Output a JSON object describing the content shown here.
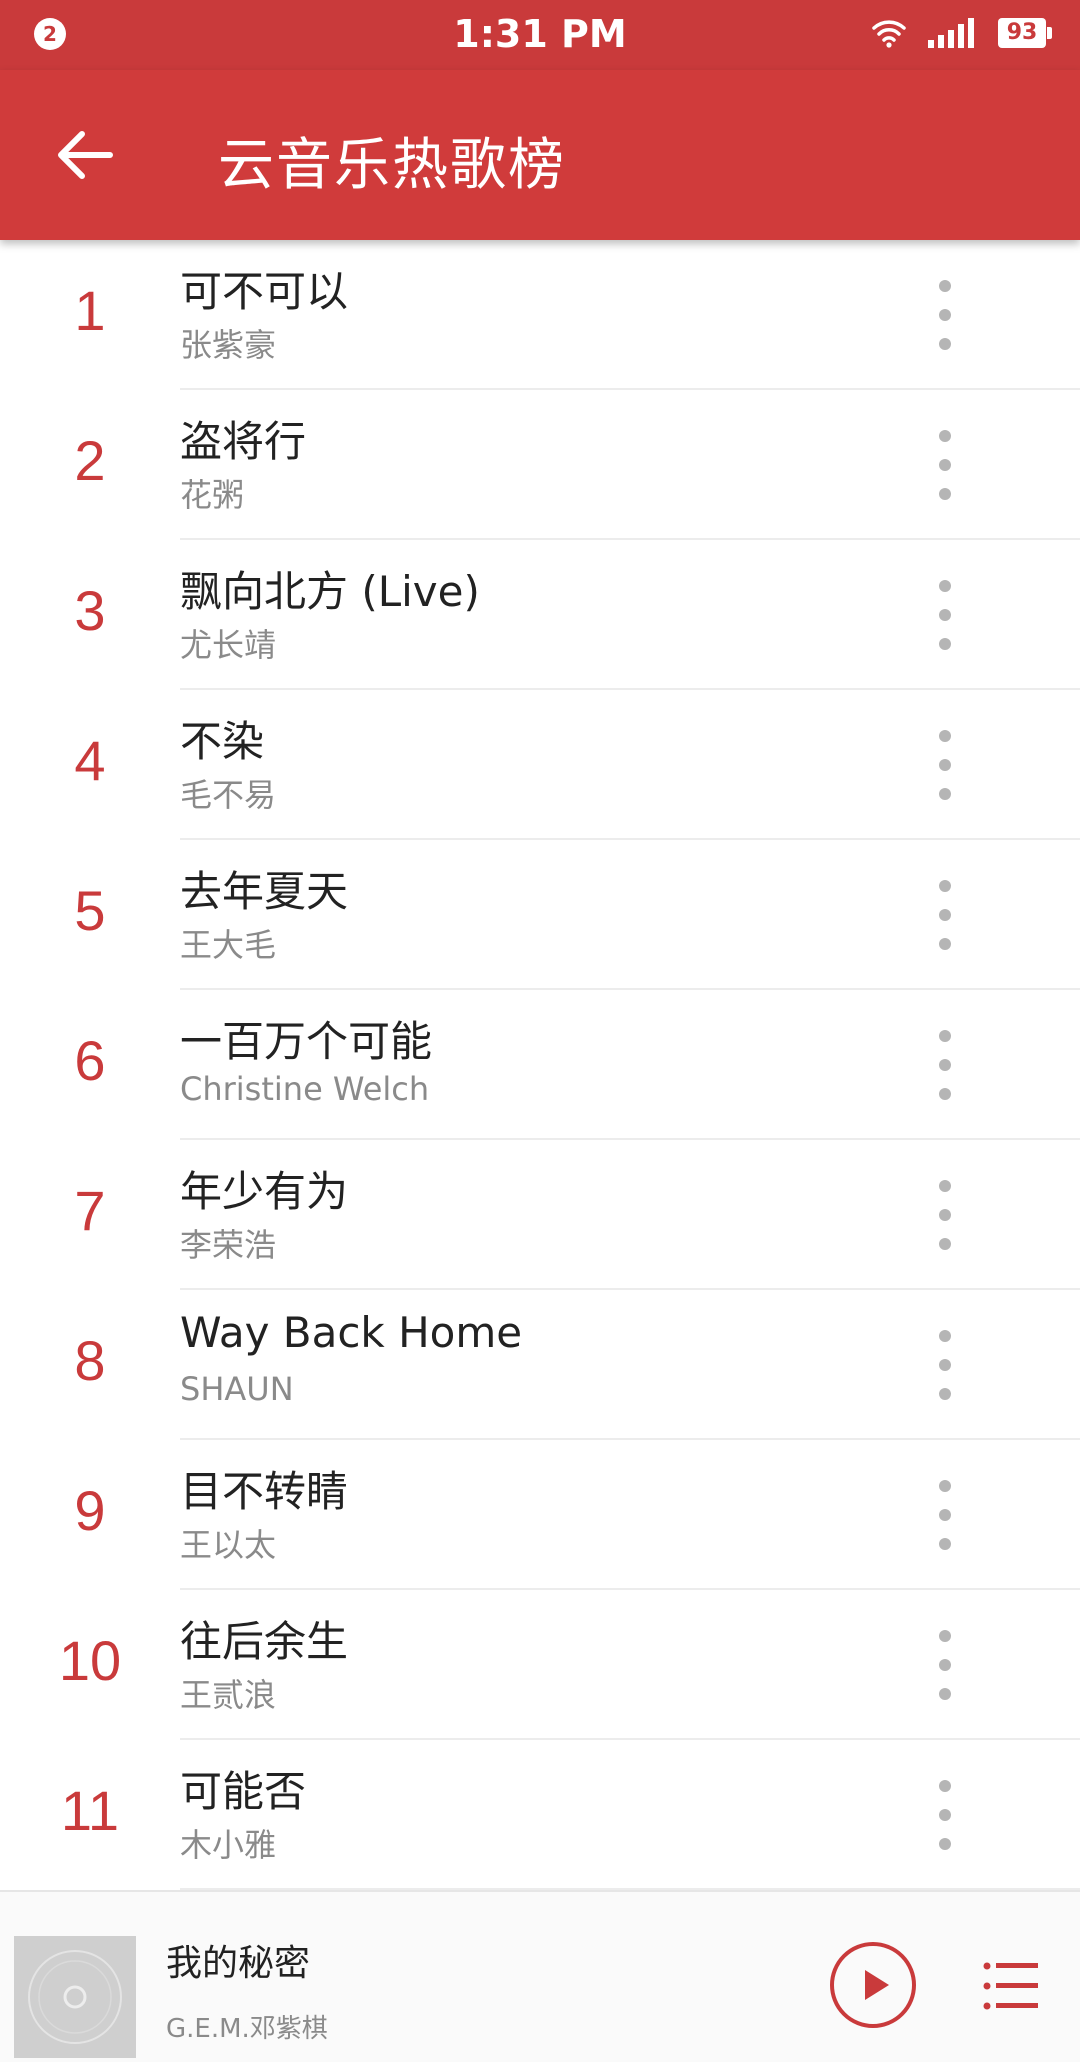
{
  "status_bar": {
    "notification_count": "2",
    "time": "1:31 PM",
    "battery": "93",
    "icons": [
      "wifi-icon",
      "signal-icon",
      "battery-icon"
    ]
  },
  "app_bar": {
    "title": "云音乐热歌榜",
    "back_icon": "arrow-left-icon"
  },
  "songs": [
    {
      "rank": "1",
      "title": "可不可以",
      "artist": "张紫豪"
    },
    {
      "rank": "2",
      "title": "盗将行",
      "artist": "花粥"
    },
    {
      "rank": "3",
      "title": "飘向北方 (Live)",
      "artist": "尤长靖"
    },
    {
      "rank": "4",
      "title": "不染",
      "artist": "毛不易"
    },
    {
      "rank": "5",
      "title": "去年夏天",
      "artist": "王大毛"
    },
    {
      "rank": "6",
      "title": "一百万个可能",
      "artist": "Christine Welch"
    },
    {
      "rank": "7",
      "title": "年少有为",
      "artist": "李荣浩"
    },
    {
      "rank": "8",
      "title": "Way Back Home",
      "artist": "SHAUN"
    },
    {
      "rank": "9",
      "title": "目不转睛",
      "artist": "王以太"
    },
    {
      "rank": "10",
      "title": "往后余生",
      "artist": "王贰浪"
    },
    {
      "rank": "11",
      "title": "可能否",
      "artist": "木小雅"
    }
  ],
  "now_playing": {
    "title": "我的秘密",
    "artist": "G.E.M.邓紫棋",
    "play_icon": "play-icon",
    "playlist_icon": "playlist-icon"
  },
  "colors": {
    "accent": "#d03b3b",
    "rank": "#c93a3b",
    "secondary_text": "#8a8a8a"
  }
}
